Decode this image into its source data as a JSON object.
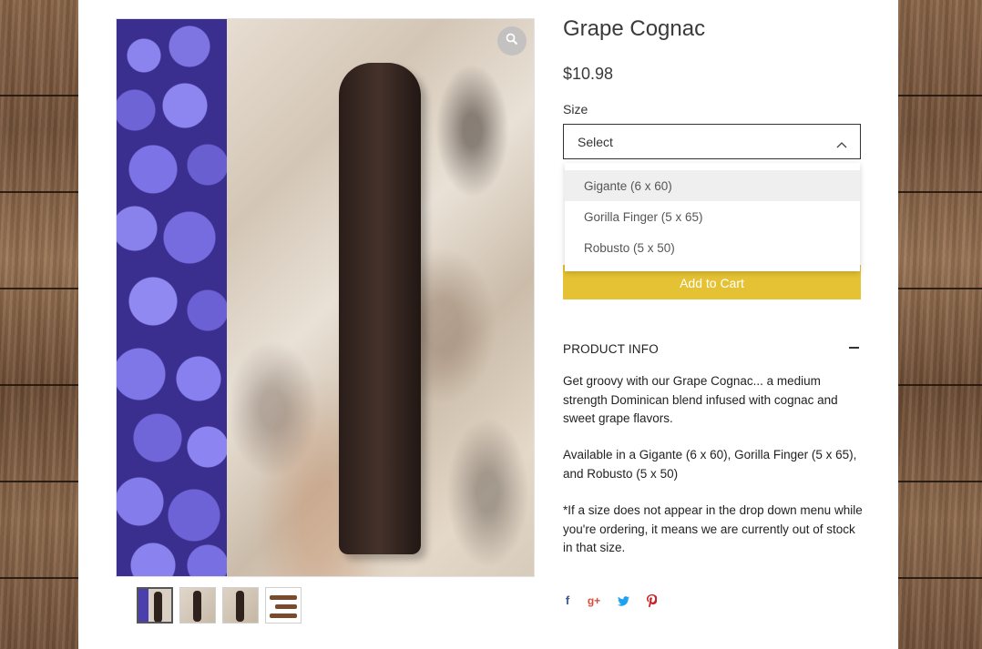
{
  "product": {
    "title": "Grape Cognac",
    "price": "$10.98"
  },
  "size": {
    "label": "Size",
    "selected": "Select",
    "options": [
      "Gigante (6 x 60)",
      "Gorilla Finger (5 x 65)",
      "Robusto (5 x 50)"
    ]
  },
  "actions": {
    "add_to_cart": "Add to Cart"
  },
  "info": {
    "header": "PRODUCT INFO",
    "paragraphs": [
      "Get groovy with our Grape Cognac... a medium strength Dominican blend infused with cognac and sweet grape flavors.",
      "Available in a Gigante (6 x 60), Gorilla Finger (5 x 65), and Robusto (5 x 50)",
      "*If a size does not appear in the drop down menu while you're ordering, it means we are currently out of stock in that size."
    ]
  },
  "share": {
    "icons": [
      "facebook-icon",
      "google-plus-icon",
      "twitter-icon",
      "pinterest-icon"
    ],
    "glyphs": [
      "f",
      "g+",
      "",
      ""
    ]
  },
  "colors": {
    "accent": "#e5c233",
    "facebook": "#3b5998",
    "google_plus": "#dd4b39",
    "twitter": "#1da1f2",
    "pinterest": "#cb2027"
  },
  "gallery": {
    "thumbnail_count": 4,
    "active_index": 0
  }
}
